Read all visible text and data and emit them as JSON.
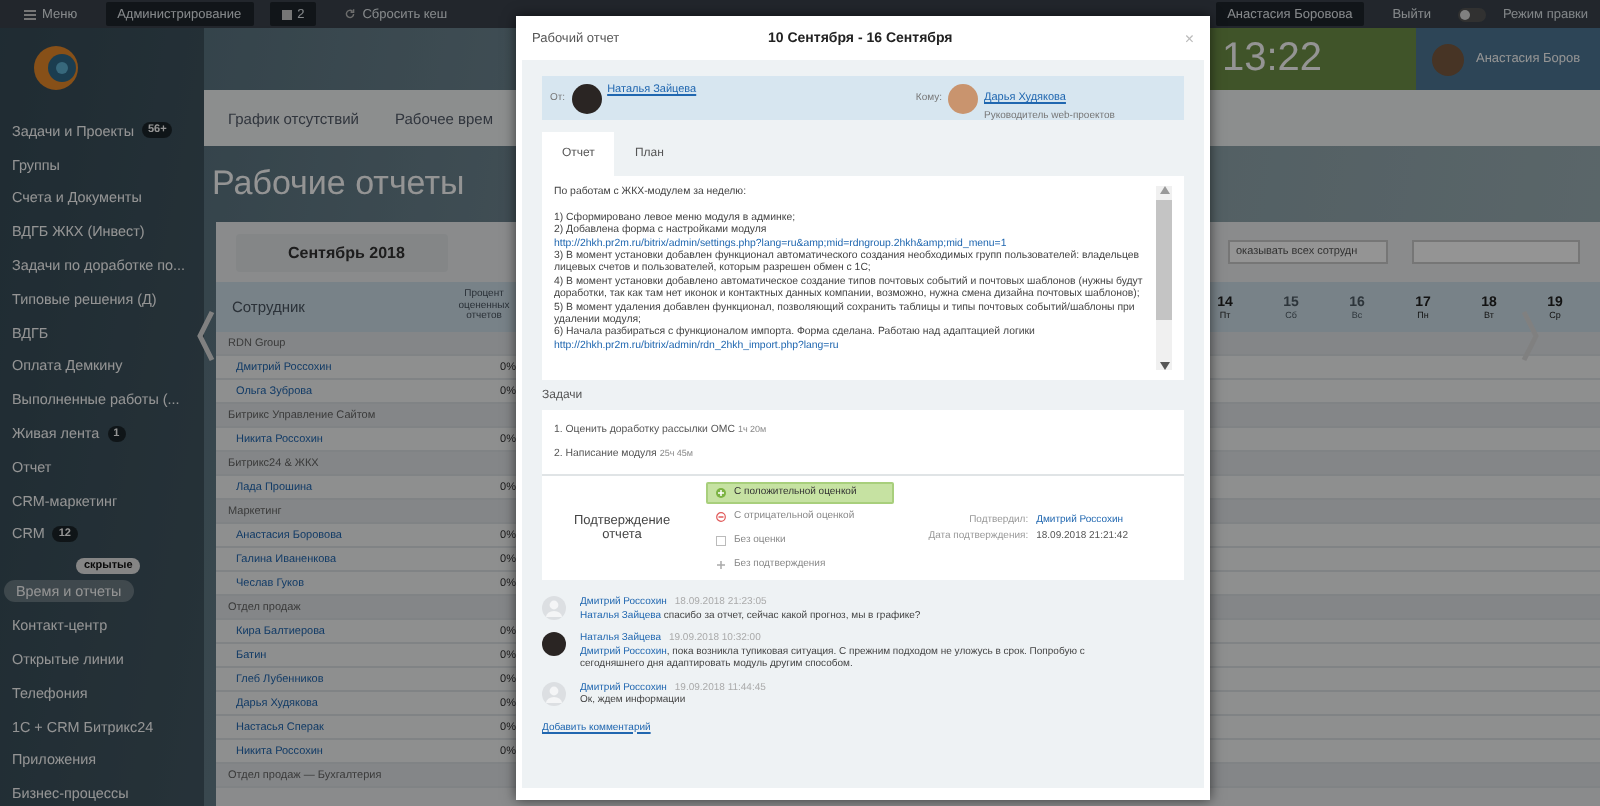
{
  "topbar": {
    "menu": "Меню",
    "admin": "Администрирование",
    "badge": "2",
    "reset_cache": "Сбросить кеш",
    "user": "Анастасия Боровова",
    "logout": "Выйти",
    "edit_mode": {
      "label": "Режим правки",
      "on": false
    }
  },
  "header": {
    "clock": "13:22",
    "user": "Анастасия Боров"
  },
  "sidebar": {
    "items": [
      {
        "label": "Задачи и Проекты",
        "counter": "56+",
        "selected": false
      },
      {
        "label": "Группы",
        "selected": false
      },
      {
        "label": "Счета и Документы",
        "selected": false
      },
      {
        "label": "ВДГБ ЖКХ (Инвест)",
        "selected": false
      },
      {
        "label": "Задачи по доработке по...",
        "selected": false
      },
      {
        "label": "Типовые решения (Д)",
        "selected": false
      },
      {
        "label": "ВДГБ",
        "selected": false
      },
      {
        "label": "Оплата Демкину",
        "selected": false
      },
      {
        "label": "Выполненные работы (...",
        "selected": false
      },
      {
        "label": "Живая лента",
        "counter": "1",
        "selected": false
      },
      {
        "label": "Отчет",
        "selected": false
      },
      {
        "label": "CRM-маркетинг",
        "selected": false
      },
      {
        "label": "CRM",
        "counter": "12",
        "selected": false
      }
    ],
    "hidden_label": "скрытые",
    "hidden_items": [
      {
        "label": "Время и отчеты",
        "selected": true
      },
      {
        "label": "Контакт-центр",
        "selected": false
      },
      {
        "label": "Открытые линии",
        "selected": false
      },
      {
        "label": "Телефония",
        "selected": false
      },
      {
        "label": "1С + CRM Битрикс24",
        "selected": false
      },
      {
        "label": "Приложения",
        "selected": false
      },
      {
        "label": "Бизнес-процессы",
        "selected": false
      }
    ]
  },
  "page_tabs": [
    "График отсутствий",
    "Рабочее врем"
  ],
  "page_title": "Рабочие отчеты",
  "month": "Сентябрь 2018",
  "filter": "оказывать всех сотрудн",
  "table": {
    "columns": [
      "Сотрудник",
      "Процент оцененных отчетов"
    ],
    "days": [
      {
        "day": "14",
        "weekday": "Пт"
      },
      {
        "day": "15",
        "weekday": "Сб"
      },
      {
        "day": "16",
        "weekday": "Вс"
      },
      {
        "day": "17",
        "weekday": "Пн"
      },
      {
        "day": "18",
        "weekday": "Вт"
      },
      {
        "day": "19",
        "weekday": "Ср"
      }
    ],
    "rows": [
      {
        "kind": "group",
        "name": "RDN Group"
      },
      {
        "kind": "person",
        "name": "Дмитрий Россохин",
        "percent": "0%"
      },
      {
        "kind": "person",
        "name": "Ольга Зуброва",
        "percent": "0%"
      },
      {
        "kind": "group",
        "name": "Битрикс Управление Сайтом"
      },
      {
        "kind": "person",
        "name": "Никита Россохин",
        "percent": "0%"
      },
      {
        "kind": "group",
        "name": "Битрикс24 & ЖКХ"
      },
      {
        "kind": "person",
        "name": "Лада Прошина",
        "percent": "0%"
      },
      {
        "kind": "group",
        "name": "Маркетинг"
      },
      {
        "kind": "person",
        "name": "Анастасия Боровова",
        "percent": "0%"
      },
      {
        "kind": "person",
        "name": "Галина Иваненкова",
        "percent": "0%"
      },
      {
        "kind": "person",
        "name": "Чеслав Гуков",
        "percent": "0%"
      },
      {
        "kind": "group",
        "name": "Отдел продаж"
      },
      {
        "kind": "person",
        "name": "Кира Балтиерова",
        "percent": "0%"
      },
      {
        "kind": "person",
        "name": "Батин",
        "percent": "0%"
      },
      {
        "kind": "person",
        "name": "Глеб Лубенников",
        "percent": "0%"
      },
      {
        "kind": "person",
        "name": "Дарья Худякова",
        "percent": "0%"
      },
      {
        "kind": "person",
        "name": "Настасья Сперак",
        "percent": "0%"
      },
      {
        "kind": "person",
        "name": "Никита Россохин",
        "percent": "0%"
      },
      {
        "kind": "group",
        "name": "Отдел продаж — Бухгалтерия"
      }
    ]
  },
  "modal": {
    "title": "Рабочий отчет",
    "period": "10 Сентября - 16 Сентября",
    "close": "×",
    "from": {
      "label": "От:",
      "name": "Наталья Зайцева"
    },
    "to": {
      "label": "Кому:",
      "name": "Дарья Худякова",
      "position": "Руководитель web-проектов"
    },
    "tabs": [
      {
        "label": "Отчет",
        "selected": true
      },
      {
        "label": "План",
        "selected": false
      }
    ],
    "report": [
      {
        "text": "По работам с ЖКХ-модулем за неделю:"
      },
      {
        "text": "1) Сформировано левое меню модуля в админке;"
      },
      {
        "text": "2) Добавлена форма с настройками модуля ",
        "link": "http://2hkh.pr2m.ru/bitrix/admin/settings.php?lang=ru&amp;mid=rdngroup.2hkh&amp;mid_menu=1"
      },
      {
        "text": "3) В момент установки добавлен функционал автоматического создания необходимых групп пользователей: владельцев лицевых счетов и пользователей, которым разрешен обмен с 1С;"
      },
      {
        "text": "4) В момент установки добавлено автоматическое создание типов почтовых событий и почтовых шаблонов (нужны будут доработки, так как там нет иконок и контактных данных компании, возможно, нужна смена дизайна почтовых шаблонов);"
      },
      {
        "text": "5) В момент удаления добавлен функционал, позволяющий сохранить таблицы и типы почтовых событий/шаблоны при удалении модуля;"
      },
      {
        "text": "6) Начала разбираться с функционалом импорта. Форма сделана. Работаю над адаптацией логики ",
        "link": "http://2hkh.pr2m.ru/bitrix/admin/rdn_2hkh_import.php?lang=ru"
      }
    ],
    "tasks_title": "Задачи",
    "tasks": [
      {
        "name": "1. Оценить доработку рассылки ОМС",
        "time": "1ч 20м"
      },
      {
        "name": "2. Написание модуля",
        "time": "25ч 45м"
      }
    ],
    "confirmation": {
      "title": "Подтверждение отчета",
      "options": [
        {
          "kind": "positive",
          "label": "С положительной оценкой",
          "selected": true
        },
        {
          "kind": "negative",
          "label": "С отрицательной оценкой",
          "selected": false
        },
        {
          "kind": "none",
          "label": "Без оценки",
          "selected": false
        },
        {
          "kind": "unconfirmed",
          "label": "Без подтверждения",
          "selected": false
        }
      ],
      "confirmed_by_label": "Подтвердил:",
      "confirmed_by": "Дмитрий Россохин",
      "date_label": "Дата подтверждения:",
      "date": "18.09.2018 21:21:42"
    },
    "comments": [
      {
        "has_photo": false,
        "author": "Дмитрий Россохин",
        "time": "18.09.2018 21:23:05",
        "mention": "Наталья Зайцева",
        "text": " спасибо за отчет, сейчас какой прогноз, мы в графике?"
      },
      {
        "has_photo": true,
        "author": "Наталья Зайцева",
        "time": "19.09.2018 10:32:00",
        "mention": "Дмитрий Россохин",
        "text": ", пока возникла тупиковая ситуация. С прежним подходом не уложусь в срок. Попробую с сегодняшнего дня адаптировать модуль другим способом."
      },
      {
        "has_photo": false,
        "author": "Дмитрий Россохин",
        "time": "19.09.2018 11:44:45",
        "text": "Ок,  ждем информации"
      }
    ],
    "add_comment": "Добавить комментарий"
  }
}
